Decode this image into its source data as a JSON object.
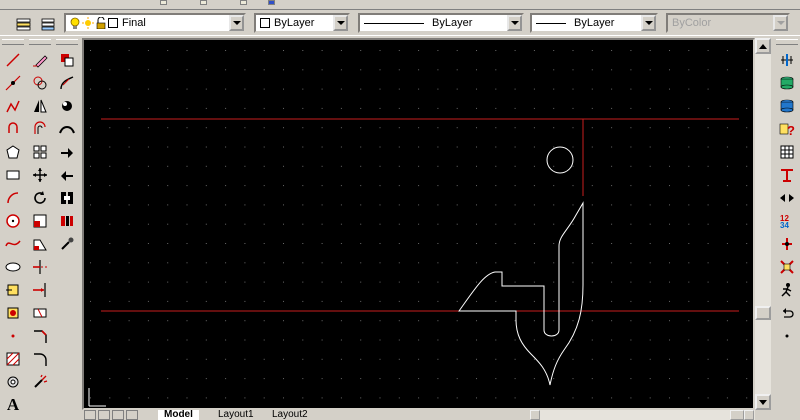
{
  "toolbar": {
    "layer_state_icons": [
      "lightbulb-icon",
      "sun-icon",
      "lock-icon",
      "color-square-icon"
    ],
    "layer": "Final",
    "color": "ByLayer",
    "linetype": "ByLayer",
    "lineweight": "ByLayer",
    "plotstyle": "ByColor"
  },
  "tabs": {
    "model": "Model",
    "layout1": "Layout1",
    "layout2": "Layout2"
  },
  "colors": {
    "canvas": "#000000",
    "grid_dots": "#6a6a6a",
    "red_lines": "#c81e1e",
    "geometry": "#ffffff",
    "chrome": "#d4d0c8"
  },
  "icons": {
    "draw": [
      "line-icon",
      "construction-line-icon",
      "polyline-icon",
      "arc-icon",
      "polygon-icon",
      "rectangle-icon",
      "arc-tool-icon",
      "circle-icon",
      "spline-icon",
      "ellipse-icon",
      "insert-block-icon",
      "make-block-icon",
      "point-icon",
      "hatch-icon",
      "region-icon",
      "text-icon"
    ],
    "modify": [
      "erase-icon",
      "copy-icon",
      "mirror-icon",
      "offset-icon",
      "array-icon",
      "move-icon",
      "rotate-icon",
      "scale-icon",
      "stretch-icon",
      "trim-icon",
      "extend-icon",
      "break-icon",
      "chamfer-icon",
      "fillet-icon",
      "explode-icon"
    ],
    "modify2": [
      "draworder-icon",
      "hatch-edit-icon",
      "polyline-edit-icon",
      "spline-edit-icon",
      "mtext-edit-icon",
      "attribute-edit-icon",
      "block-attribute-icon",
      "match-properties-icon"
    ],
    "right": [
      "dimension-icon",
      "database-icon",
      "database-connect-icon",
      "query-icon",
      "table-icon",
      "text-style-icon",
      "compare-icon",
      "attribute-icon",
      "xref-icon",
      "purge-icon",
      "run-icon",
      "undo-icon"
    ]
  }
}
